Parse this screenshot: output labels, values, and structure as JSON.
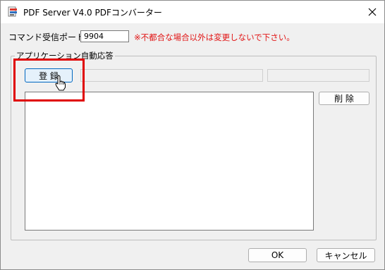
{
  "window": {
    "title": "PDF Server V4.0 PDFコンバーター",
    "icon": "pdf-app-icon",
    "close_icon": "close-icon"
  },
  "port": {
    "label": "コマンド受信ポート",
    "value": "9904",
    "warning": "※不都合な場合以外は変更しないで下さい。",
    "warning_color": "#e11414"
  },
  "group": {
    "title": "アプリケーション自動応答",
    "register_label": "登 録",
    "delete_label": "削 除"
  },
  "footer": {
    "ok_label": "OK",
    "cancel_label": "キャンセル"
  },
  "annotation": {
    "highlight_color": "#e00000"
  }
}
